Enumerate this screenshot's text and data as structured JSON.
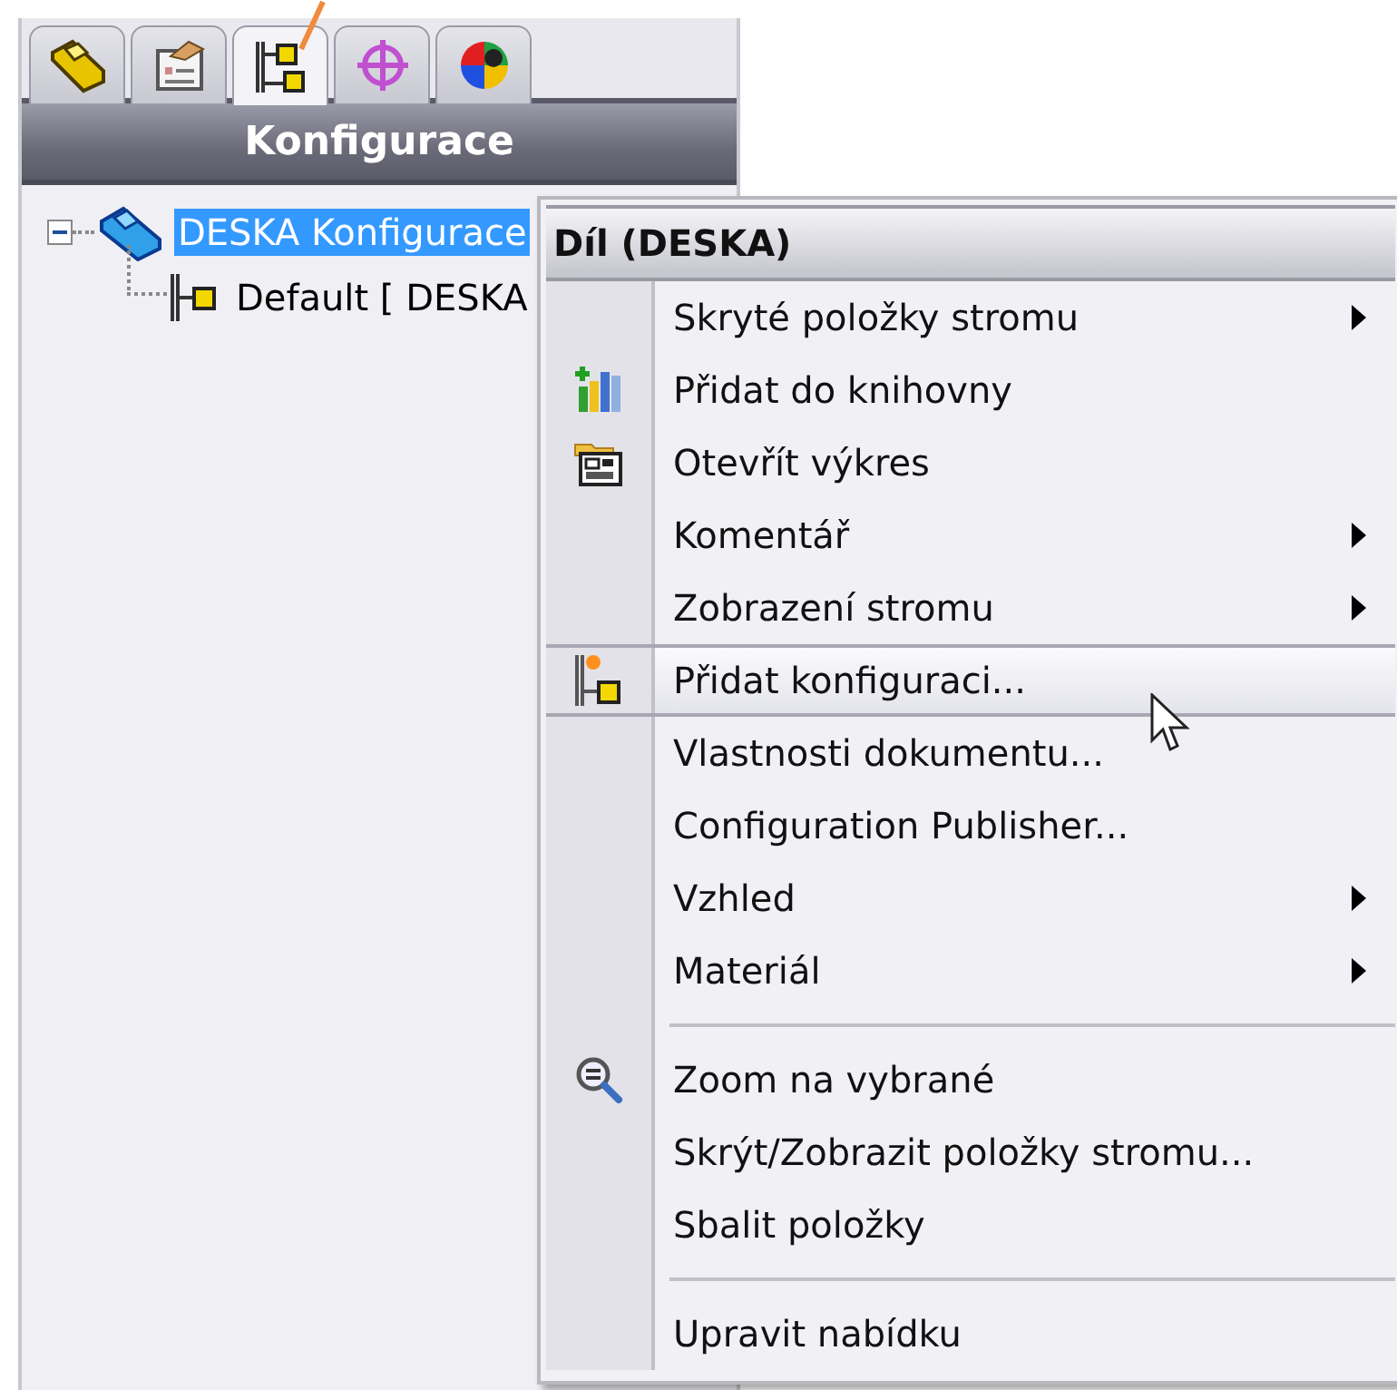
{
  "panel": {
    "tabs": [
      {
        "selected": false
      },
      {
        "selected": false
      },
      {
        "selected": true
      },
      {
        "selected": false
      },
      {
        "selected": false
      }
    ],
    "title": "Konfigurace",
    "tree": [
      {
        "label": "DESKA Konfigurace",
        "selected": true,
        "expanded": true,
        "children": [
          {
            "label": "Default [ DESKA",
            "selected": false
          }
        ]
      }
    ]
  },
  "context_menu": {
    "title": "Díl (DESKA)",
    "items": [
      {
        "kind": "item",
        "label": "Skryté položky stromu",
        "submenu": true,
        "selected": false
      },
      {
        "kind": "item",
        "label": "Přidat do knihovny",
        "submenu": false,
        "selected": false
      },
      {
        "kind": "item",
        "label": "Otevřít výkres",
        "submenu": false,
        "selected": false
      },
      {
        "kind": "item",
        "label": "Komentář",
        "submenu": true,
        "selected": false
      },
      {
        "kind": "item",
        "label": "Zobrazení stromu",
        "submenu": true,
        "selected": false
      },
      {
        "kind": "item",
        "label": "Přidat konfiguraci...",
        "submenu": false,
        "selected": true
      },
      {
        "kind": "item",
        "label": "Vlastnosti dokumentu...",
        "submenu": false,
        "selected": false
      },
      {
        "kind": "item",
        "label": "Configuration Publisher...",
        "submenu": false,
        "selected": false
      },
      {
        "kind": "item",
        "label": "Vzhled",
        "submenu": true,
        "selected": false
      },
      {
        "kind": "item",
        "label": "Materiál",
        "submenu": true,
        "selected": false
      },
      {
        "kind": "separator"
      },
      {
        "kind": "item",
        "label": "Zoom na vybrané",
        "submenu": false,
        "selected": false
      },
      {
        "kind": "item",
        "label": "Skrýt/Zobrazit položky stromu...",
        "submenu": false,
        "selected": false
      },
      {
        "kind": "item",
        "label": "Sbalit položky",
        "submenu": false,
        "selected": false
      },
      {
        "kind": "separator"
      },
      {
        "kind": "item",
        "label": "Upravit nabídku",
        "submenu": false,
        "selected": false
      }
    ]
  }
}
